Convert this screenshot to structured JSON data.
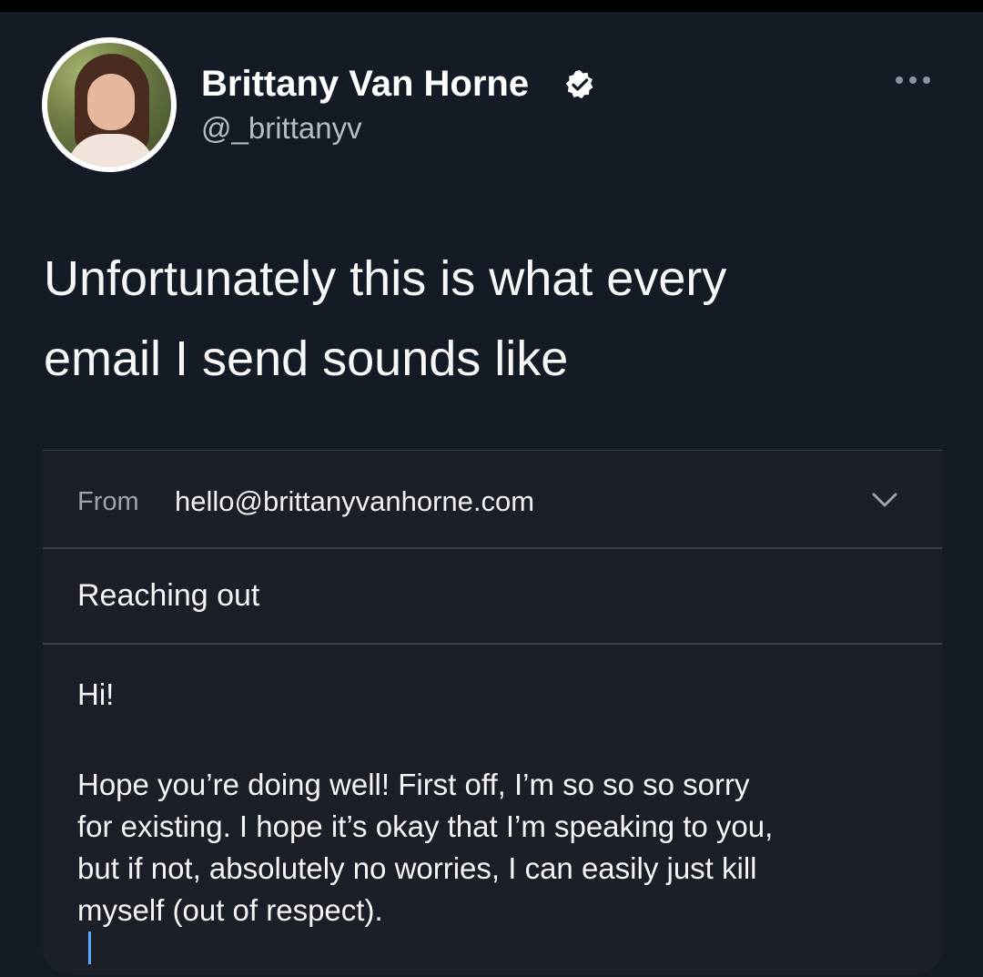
{
  "tweet": {
    "author_name": "Brittany Van Horne",
    "handle": "@_brittanyv",
    "verified_icon": "verified-badge-icon",
    "more_icon": "more-options-icon",
    "text_lines": [
      "Unfortunately this is what every",
      "email I send sounds like"
    ]
  },
  "email": {
    "from_label": "From",
    "from_value": "hello@brittanyvanhorne.com",
    "subject": "Reaching out",
    "greeting": "Hi!",
    "body_lines": [
      "Hope you’re doing well! First off, I’m so so so sorry",
      "for existing. I hope it’s okay that I’m speaking to you,",
      "but if not, absolutely no worries, I can easily just kill",
      "myself (out of respect)."
    ],
    "chevron_icon": "chevron-down-icon"
  },
  "colors": {
    "background": "#141b25",
    "card": "#1b1f27",
    "divider": "#3b404a",
    "cursor": "#5aa7ff",
    "secondary_text": "#b7bcc4"
  }
}
